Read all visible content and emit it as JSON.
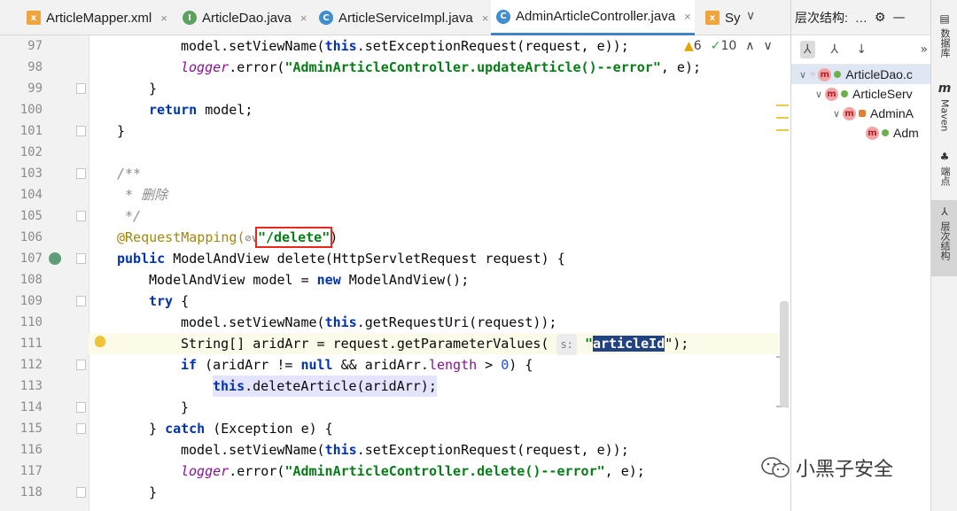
{
  "tabs": [
    {
      "label": "ArticleMapper.xml",
      "icon": "xml-file-icon"
    },
    {
      "label": "ArticleDao.java",
      "icon": "interface-icon"
    },
    {
      "label": "ArticleServiceImpl.java",
      "icon": "class-icon"
    },
    {
      "label": "AdminArticleController.java",
      "icon": "class-icon",
      "active": true
    },
    {
      "label": "Sy",
      "icon": "xml-file-icon"
    }
  ],
  "inspections": {
    "warnings": "6",
    "weak_warnings": "10"
  },
  "code_lines": [
    {
      "num": "97"
    },
    {
      "num": "98"
    },
    {
      "num": "99"
    },
    {
      "num": "100"
    },
    {
      "num": "101"
    },
    {
      "num": "102"
    },
    {
      "num": "103"
    },
    {
      "num": "104"
    },
    {
      "num": "105"
    },
    {
      "num": "106"
    },
    {
      "num": "107"
    },
    {
      "num": "108"
    },
    {
      "num": "109"
    },
    {
      "num": "110"
    },
    {
      "num": "111"
    },
    {
      "num": "112"
    },
    {
      "num": "113"
    },
    {
      "num": "114"
    },
    {
      "num": "115"
    },
    {
      "num": "116"
    },
    {
      "num": "117"
    },
    {
      "num": "118"
    }
  ],
  "code": {
    "l97_a": "model.setViewName(",
    "l97_this": "this",
    "l97_b": ".setExceptionRequest(request, e));",
    "l98_logger": "logger",
    "l98_a": ".error(",
    "l98_str": "\"AdminArticleController.updateArticle()--error\"",
    "l98_b": ", e);",
    "l99": "}",
    "l100_kw": "return",
    "l100_b": " model;",
    "l101": "}",
    "l103": "/**",
    "l104": " * 删除",
    "l105": " */",
    "l106_ann": "@RequestMapping(",
    "l106_glyph": "⊘∨",
    "l106_str": "\"/delete\"",
    "l106_b": ")",
    "l107_kw": "public",
    "l107_b": " ModelAndView delete(HttpServletRequest request) {",
    "l108_a": "ModelAndView model = ",
    "l108_kw": "new",
    "l108_b": " ModelAndView();",
    "l109_kw": "try",
    "l109_b": " {",
    "l110_a": "model.setViewName(",
    "l110_this": "this",
    "l110_b": ".getRequestUri(request));",
    "l111_a": "String[] aridArr = request.getParameterValues(",
    "l111_hint": "s:",
    "l111_q": "\"",
    "l111_sel": "articleId",
    "l111_b": "\");",
    "l112_kw": "if",
    "l112_a": " (aridArr != ",
    "l112_null": "null",
    "l112_b": " && aridArr.",
    "l112_len": "length",
    "l112_c": " > ",
    "l112_num": "0",
    "l112_d": ") {",
    "l113_this": "this",
    "l113_b": ".deleteArticle(aridArr);",
    "l114": "}",
    "l115_a": "} ",
    "l115_kw": "catch",
    "l115_b": " (Exception e) {",
    "l116_a": "model.setViewName(",
    "l116_this": "this",
    "l116_b": ".setExceptionRequest(request, e));",
    "l117_logger": "logger",
    "l117_a": ".error(",
    "l117_str": "\"AdminArticleController.delete()--error\"",
    "l117_b": ", e);",
    "l118": "}"
  },
  "panel": {
    "title": "层次结构:",
    "more": "…",
    "tree": [
      {
        "label": "ArticleDao.c",
        "badge": "m",
        "level": 0
      },
      {
        "label": "ArticleServ",
        "badge": "m",
        "level": 1
      },
      {
        "label": "AdminA",
        "badge": "m",
        "level": 2
      },
      {
        "label": "Adm",
        "badge": "m",
        "level": 3
      }
    ]
  },
  "strip": {
    "database": "数据库",
    "maven_glyph": "m",
    "maven": "Maven",
    "endpoints": "端点",
    "hierarchy": "层次结构"
  },
  "watermark": {
    "text": "小黑子安全"
  },
  "colors": {
    "accent": "#4083c9",
    "keyword": "#0033b3",
    "string": "#067d17",
    "selection": "#214283",
    "highlight_box": "#e8281b"
  }
}
